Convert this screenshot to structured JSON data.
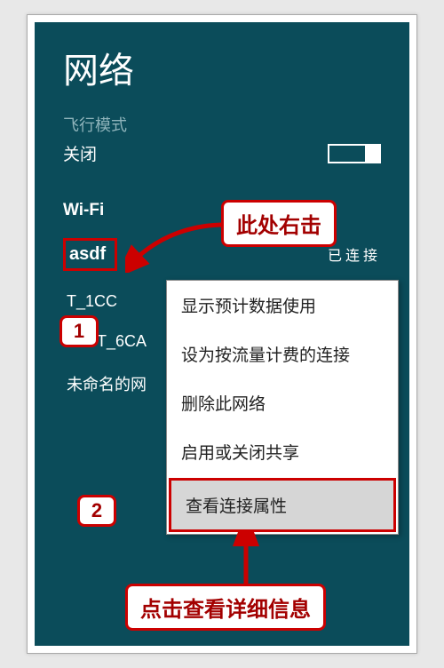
{
  "title": "网络",
  "airplane_label": "飞行模式",
  "airplane_status": "关闭",
  "wifi_header": "Wi-Fi",
  "connected_label": "已连接",
  "networks": {
    "selected": "asdf",
    "items": [
      "T_1CC",
      "FAST_6CA",
      "未命名的网"
    ]
  },
  "context_menu": {
    "items": [
      "显示预计数据使用",
      "设为按流量计费的连接",
      "删除此网络",
      "启用或关闭共享",
      "查看连接属性"
    ]
  },
  "annotations": {
    "top_callout": "此处右击",
    "bottom_callout": "点击查看详细信息",
    "step1": "1",
    "step2": "2"
  }
}
